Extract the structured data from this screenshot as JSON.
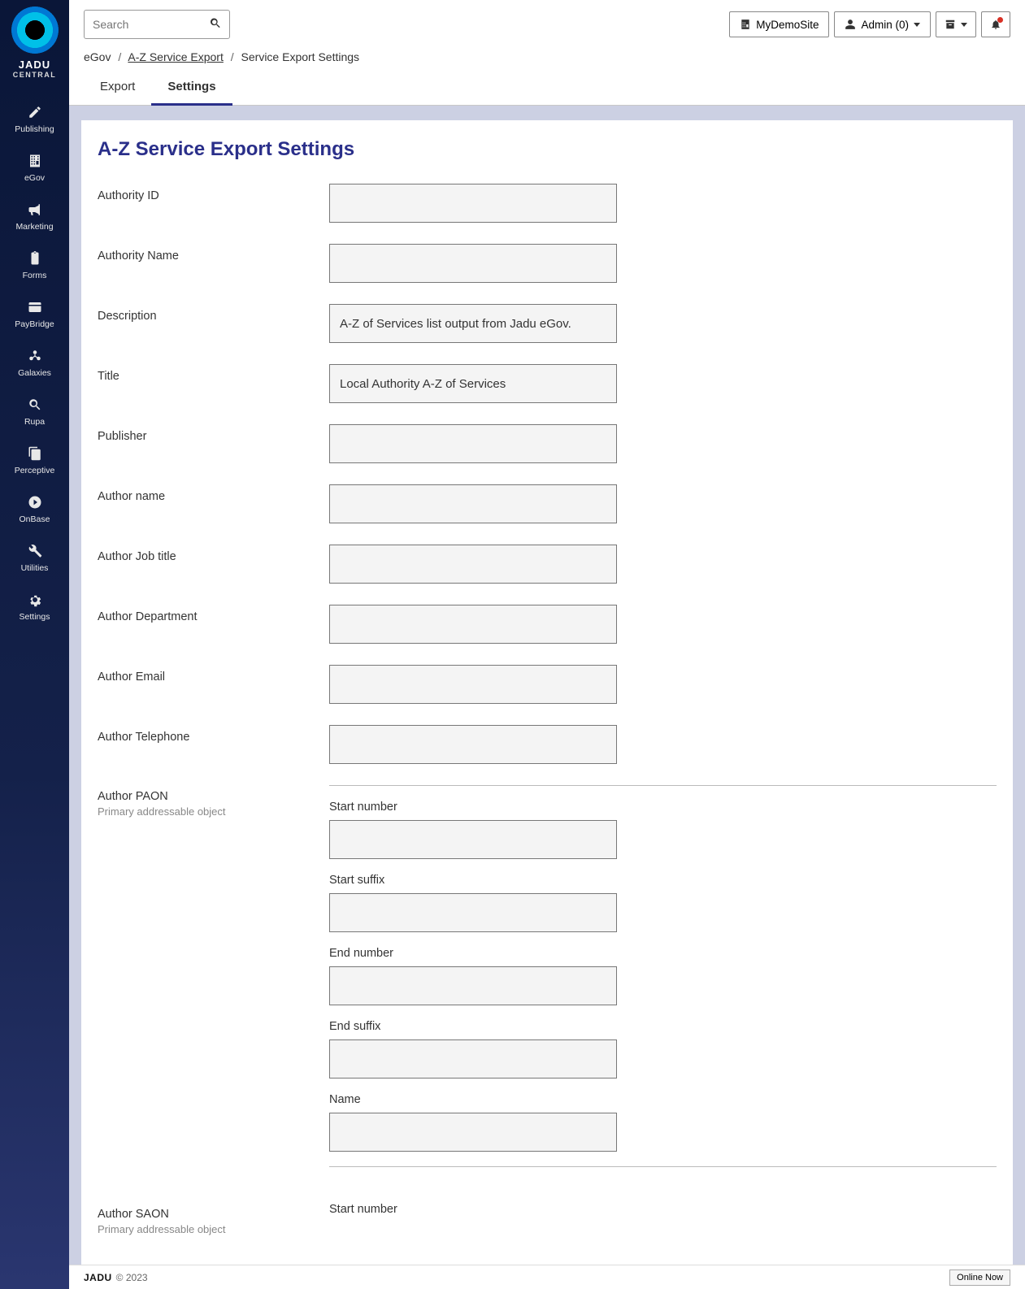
{
  "brand": {
    "name": "JADU",
    "sub": "CENTRAL"
  },
  "search": {
    "placeholder": "Search"
  },
  "sidebar": {
    "items": [
      {
        "label": "Publishing"
      },
      {
        "label": "eGov"
      },
      {
        "label": "Marketing"
      },
      {
        "label": "Forms"
      },
      {
        "label": "PayBridge"
      },
      {
        "label": "Galaxies"
      },
      {
        "label": "Rupa"
      },
      {
        "label": "Perceptive"
      },
      {
        "label": "OnBase"
      },
      {
        "label": "Utilities"
      },
      {
        "label": "Settings"
      }
    ]
  },
  "topbar": {
    "site": "MyDemoSite",
    "user": "Admin (0)"
  },
  "breadcrumb": {
    "root": "eGov",
    "link": "A-Z Service Export",
    "current": "Service Export Settings"
  },
  "tabs": {
    "export": "Export",
    "settings": "Settings"
  },
  "page": {
    "title": "A-Z Service Export Settings"
  },
  "form": {
    "authority_id": {
      "label": "Authority ID",
      "value": ""
    },
    "authority_name": {
      "label": "Authority Name",
      "value": ""
    },
    "description": {
      "label": "Description",
      "value": "A-Z of Services list output from Jadu eGov."
    },
    "title": {
      "label": "Title",
      "value": "Local Authority A-Z of Services"
    },
    "publisher": {
      "label": "Publisher",
      "value": ""
    },
    "author_name": {
      "label": "Author name",
      "value": ""
    },
    "author_job": {
      "label": "Author Job title",
      "value": ""
    },
    "author_dept": {
      "label": "Author Department",
      "value": ""
    },
    "author_email": {
      "label": "Author Email",
      "value": ""
    },
    "author_tel": {
      "label": "Author Telephone",
      "value": ""
    },
    "author_paon": {
      "label": "Author PAON",
      "hint": "Primary addressable object",
      "start_number": "Start number",
      "start_suffix": "Start suffix",
      "end_number": "End number",
      "end_suffix": "End suffix",
      "name": "Name"
    },
    "author_saon": {
      "label": "Author SAON",
      "hint": "Primary addressable object",
      "start_number": "Start number"
    }
  },
  "footer": {
    "brand": "JADU",
    "copy": "© 2023",
    "online": "Online Now"
  }
}
